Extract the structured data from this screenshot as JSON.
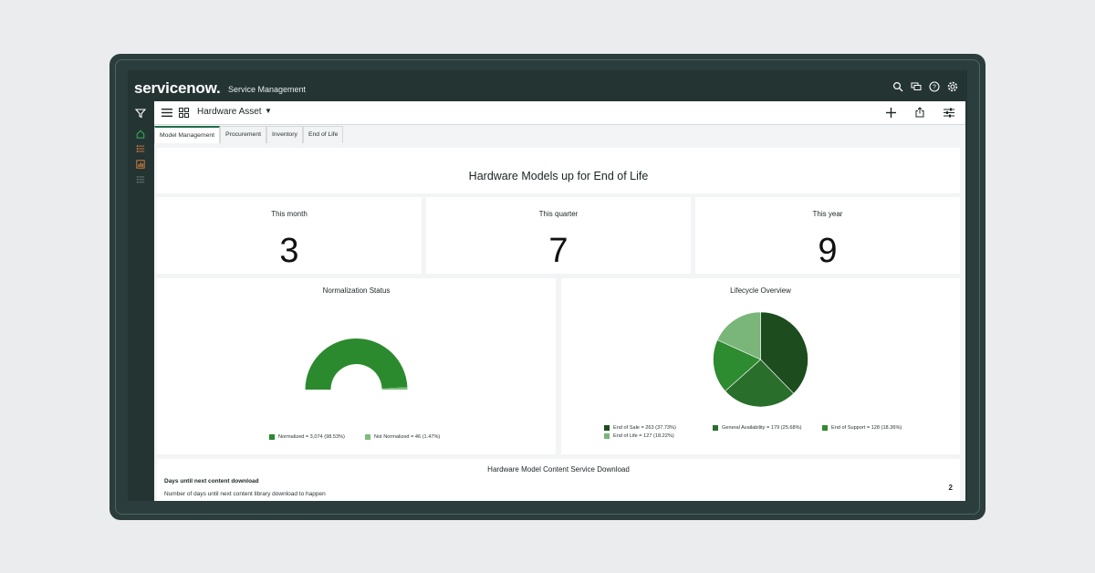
{
  "brand": {
    "logo": "servicenow.",
    "product": "Service Management"
  },
  "toolbar": {
    "title": "Hardware Asset",
    "caret": "▼"
  },
  "tabs": [
    {
      "label": "Model Management",
      "active": true
    },
    {
      "label": "Procurement",
      "active": false
    },
    {
      "label": "Inventory",
      "active": false
    },
    {
      "label": "End of Life",
      "active": false
    }
  ],
  "dashboard": {
    "heading": "Hardware Models up for End of Life",
    "stats": [
      {
        "label": "This month",
        "value": "3"
      },
      {
        "label": "This quarter",
        "value": "7"
      },
      {
        "label": "This year",
        "value": "9"
      }
    ]
  },
  "chart_data": [
    {
      "type": "pie",
      "variant": "semi-donut",
      "title": "Normalization Status",
      "slices": [
        {
          "name": "Normalized",
          "value": 3074,
          "percent": 98.53,
          "color": "#2b8a2e",
          "legend": "Normalized = 3,074 (98.53%)"
        },
        {
          "name": "Not Normalized",
          "value": 46,
          "percent": 1.47,
          "color": "#7cbd7e",
          "legend": "Not Normalized = 46 (1.47%)"
        }
      ],
      "legend_position": "bottom"
    },
    {
      "type": "pie",
      "title": "Lifecycle Overview",
      "slices": [
        {
          "name": "End of Sale",
          "value": 263,
          "percent": 37.73,
          "color": "#1d4d1e",
          "legend": "End of Sale = 263 (37.73%)"
        },
        {
          "name": "General Availability",
          "value": 179,
          "percent": 25.68,
          "color": "#2a6e2c",
          "legend": "General Availability = 179 (25.68%)"
        },
        {
          "name": "End of Support",
          "value": 128,
          "percent": 18.36,
          "color": "#2d8b30",
          "legend": "End of Support = 128 (18.36%)"
        },
        {
          "name": "End of Life",
          "value": 127,
          "percent": 18.22,
          "color": "#7ab57a",
          "legend": "End of Life = 127 (18.22%)"
        }
      ],
      "legend_position": "bottom"
    }
  ],
  "download": {
    "title": "Hardware Model Content Service Download",
    "subtitle": "Days until next content download",
    "description": "Number of days until next content library download to happen",
    "value": "2"
  },
  "colors": {
    "frame": "#2b3d3c",
    "accent_green": "#2b8a2e",
    "header": "#243433"
  }
}
